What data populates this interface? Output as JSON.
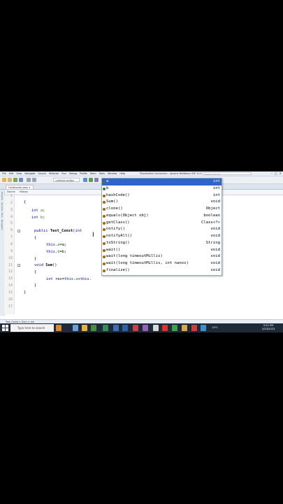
{
  "window": {
    "title": "Placeholder.Conversion - Apache NetBeans IDE 12.0",
    "menu": [
      "File",
      "Edit",
      "View",
      "Navigate",
      "Source",
      "Refactor",
      "Run",
      "Debug",
      "Profile",
      "Team",
      "Tools",
      "Window",
      "Help"
    ],
    "search_placeholder": "Search (Ctrl+I)",
    "controls": [
      "–",
      "□",
      "✕"
    ]
  },
  "toolbar": {
    "config_label": "<default config>"
  },
  "tabs": [
    {
      "label": "Constructor.java ×"
    }
  ],
  "subtabs": [
    "Source",
    "History"
  ],
  "sidebar": [
    "Projects",
    "Services",
    "Files",
    "Navigator"
  ],
  "editor": {
    "line_numbers": [
      "1",
      "2",
      "3",
      "4",
      "5",
      "6",
      "7",
      "8",
      "9",
      "10",
      "11",
      "12",
      "13",
      "14",
      "15",
      "16",
      "17"
    ]
  },
  "completion": {
    "items": [
      {
        "name": "a",
        "type": "int",
        "icon_color": "#3c7a3c",
        "selected": true
      },
      {
        "name": "b",
        "type": "int",
        "icon_color": "#3c7a3c"
      },
      {
        "name": "hashCode()",
        "type": "int",
        "icon_color": "#b06000"
      },
      {
        "name": "Sum()",
        "type": "void",
        "icon_color": "#b06000"
      },
      {
        "name": "clone()",
        "type": "Object",
        "icon_color": "#b06000"
      },
      {
        "name": "equals(Object obj)",
        "type": "boolean",
        "icon_color": "#b06000"
      },
      {
        "name": "getClass()",
        "type": "Class<?>",
        "icon_color": "#b06000"
      },
      {
        "name": "notify()",
        "type": "void",
        "icon_color": "#b06000"
      },
      {
        "name": "notifyAll()",
        "type": "void",
        "icon_color": "#b06000"
      },
      {
        "name": "toString()",
        "type": "String",
        "icon_color": "#b06000"
      },
      {
        "name": "wait()",
        "type": "void",
        "icon_color": "#b06000"
      },
      {
        "name": "wait(long timeoutMillis)",
        "type": "void",
        "icon_color": "#b06000"
      },
      {
        "name": "wait(long timeoutMillis, int nanos)",
        "type": "void",
        "icon_color": "#b06000"
      },
      {
        "name": "finalize()",
        "type": "void",
        "icon_color": "#b06000"
      }
    ]
  },
  "bottom": {
    "breadcrumb": "Test_Const  >  Sum  >  res",
    "output_label": "Output",
    "position": "13:29",
    "insert_mode": "INS",
    "line_ending": "Windows (CRLF)"
  },
  "taskbar": {
    "search_placeholder": "Type here to search",
    "temperature": "13°C",
    "time": "9:52 PM",
    "date": "2/23/2023"
  },
  "colors": {
    "accent": "#2f65ca",
    "keyword": "#0000e6",
    "field": "#009900"
  }
}
